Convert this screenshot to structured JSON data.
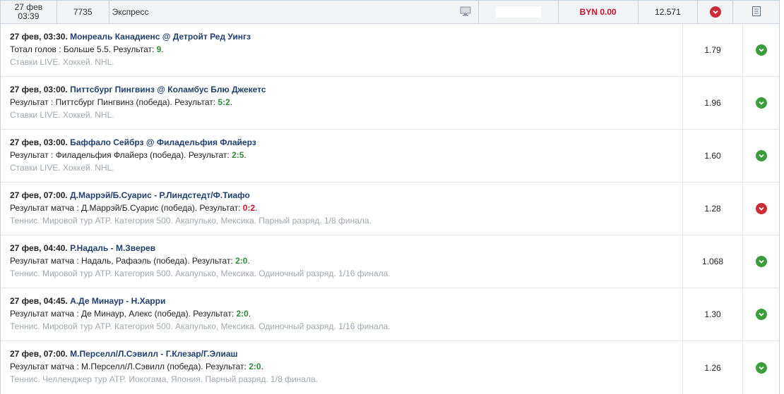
{
  "header": {
    "date": "27 фев",
    "time": "03:39",
    "number": "7735",
    "type": "Экспресс",
    "stake": "BYN 0.00",
    "coefficient": "12.571",
    "status": "lose",
    "icons": {
      "tv": "tv-icon",
      "doc": "document-icon",
      "status": "cross-circle-icon"
    }
  },
  "bets": [
    {
      "datetime": "27 фев, 03:30.",
      "event": "Монреаль Канадиенс @ Детройт Ред Уингз",
      "selection": "Тотал голов : Больше 5.5. Результат: ",
      "score": "9",
      "score_tail": ".",
      "outcome": "win",
      "league": "Ставки LIVE. Хоккей. NHL.",
      "odds": "1.79"
    },
    {
      "datetime": "27 фев, 03:00.",
      "event": "Питтсбург Пингвинз @ Коламбус Блю Джекетс",
      "selection": "Результат : Питтсбург Пингвинз (победа). Результат: ",
      "score": "5:2",
      "score_tail": ".",
      "outcome": "win",
      "league": "Ставки LIVE. Хоккей. NHL.",
      "odds": "1.96"
    },
    {
      "datetime": "27 фев, 03:00.",
      "event": "Баффало Сейбрз @ Филадельфия Флайерз",
      "selection": "Результат : Филадельфия Флайерз (победа). Результат: ",
      "score": "2:5",
      "score_tail": ".",
      "outcome": "win",
      "league": "Ставки LIVE. Хоккей. NHL.",
      "odds": "1.60"
    },
    {
      "datetime": "27 фев, 07:00.",
      "event": "Д.Маррэй/Б.Суарис - Р.Линдстедт/Ф.Тиафо",
      "selection": "Результат матча : Д.Маррэй/Б.Суарис (победа). Результат: ",
      "score": "0:2",
      "score_tail": ".",
      "outcome": "lose",
      "league": "Теннис. Мировой тур ATP. Категория 500. Акапулько, Мексика. Парный разряд. 1/8 финала.",
      "odds": "1.28"
    },
    {
      "datetime": "27 фев, 04:40.",
      "event": "Р.Надаль - М.Зверев",
      "selection": "Результат матча : Надаль, Рафаэль (победа). Результат: ",
      "score": "2:0",
      "score_tail": ".",
      "outcome": "win",
      "league": "Теннис. Мировой тур ATP. Категория 500. Акапулько, Мексика. Одиночный разряд. 1/16 финала.",
      "odds": "1.068"
    },
    {
      "datetime": "27 фев, 04:45.",
      "event": "А.Де Минаур - Н.Харри",
      "selection": "Результат матча : Де Минаур, Алекс (победа). Результат: ",
      "score": "2:0",
      "score_tail": ".",
      "outcome": "win",
      "league": "Теннис. Мировой тур ATP. Категория 500. Акапулько, Мексика. Одиночный разряд. 1/16 финала.",
      "odds": "1.30"
    },
    {
      "datetime": "27 фев, 07:00.",
      "event": "М.Перселл/Л.Сэвилл - Г.Клезар/Г.Элиаш",
      "selection": "Результат матча : М.Перселл/Л.Сэвилл (победа). Результат: ",
      "score": "2:0",
      "score_tail": ".",
      "outcome": "win",
      "league": "Теннис. Челленджер тур ATP. Иокогама, Япония. Парный разряд. 1/8 финала.",
      "odds": "1.26"
    }
  ],
  "colors": {
    "win": "#3a9c3a",
    "lose": "#cc2b36",
    "event": "#1f3f6e",
    "muted": "#a0a7b0"
  }
}
